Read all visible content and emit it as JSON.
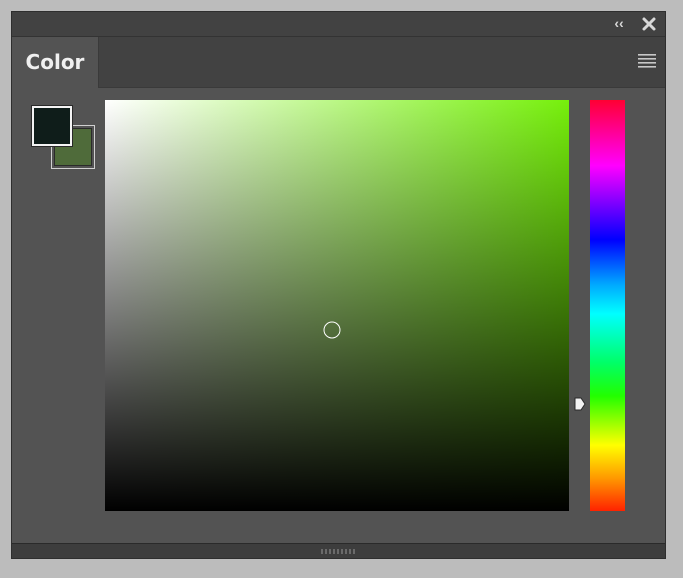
{
  "panel": {
    "tab_label": "Color",
    "tab_active": true
  },
  "title_bar": {
    "collapse_label": "‹‹",
    "collapse_icon": "double-chevron-left-icon",
    "close_icon": "close-icon",
    "menu_icon": "hamburger-menu-icon"
  },
  "swatches": {
    "foreground_color": "#0f1d1a",
    "background_color": "#4f6b3a"
  },
  "picker": {
    "hue_color": "#76f00b",
    "saturation_fraction": 0.49,
    "brightness_fraction": 0.44,
    "hue_position_fraction": 0.74
  },
  "colors": {
    "panel_bg": "#535353",
    "header_bg": "#424242",
    "text": "#f0f0f0"
  }
}
